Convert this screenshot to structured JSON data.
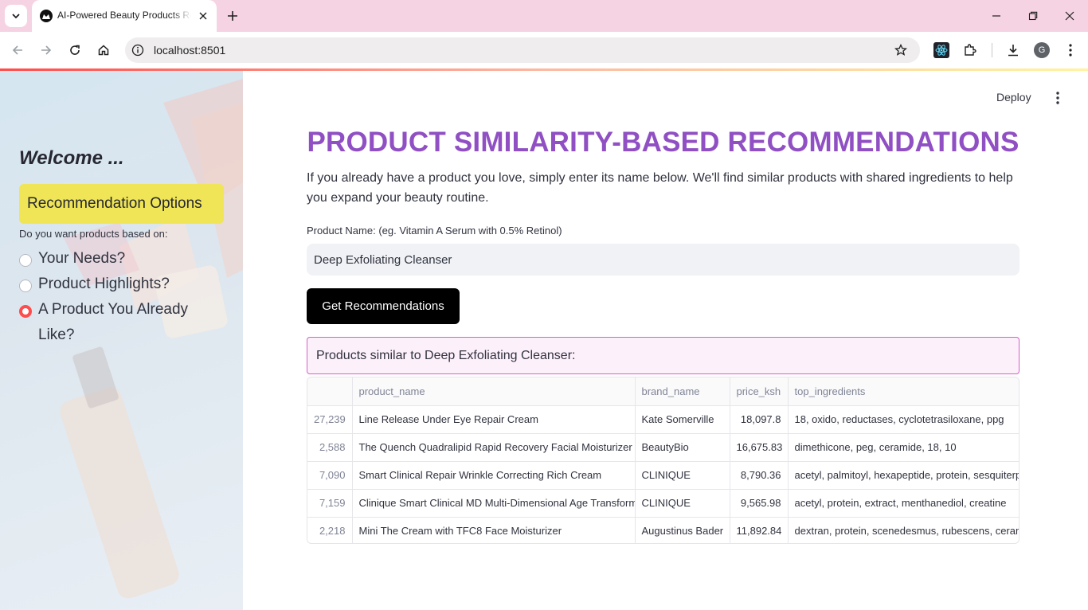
{
  "browser": {
    "tab_title": "AI-Powered Beauty Products Recommender",
    "url": "localhost:8501",
    "profile_initial": "G"
  },
  "sidebar": {
    "welcome": "Welcome ...",
    "options_header": "Recommendation Options",
    "question": "Do you want products based on:",
    "radio_options": [
      {
        "label": "Your Needs?",
        "selected": false
      },
      {
        "label": "Product Highlights?",
        "selected": false
      },
      {
        "label": "A Product You Already Like?",
        "selected": true
      }
    ]
  },
  "header": {
    "deploy_label": "Deploy"
  },
  "main": {
    "title": "PRODUCT SIMILARITY-BASED RECOMMENDATIONS",
    "intro": "If you already have a product you love, simply enter its name below. We'll find similar products with shared ingredients to help you expand your beauty routine.",
    "input_label": "Product Name: (eg. Vitamin A Serum with 0.5% Retinol)",
    "input_value": "Deep Exfoliating Cleanser",
    "button_label": "Get Recommendations",
    "result_message": "Products similar to Deep Exfoliating Cleanser:",
    "table": {
      "columns": [
        "",
        "product_name",
        "brand_name",
        "price_ksh",
        "top_ingredients"
      ],
      "rows": [
        [
          "27,239",
          "Line Release Under Eye Repair Cream",
          "Kate Somerville",
          "18,097.8",
          "18, oxido, reductases, cyclotetrasiloxane, ppg"
        ],
        [
          "2,588",
          "The Quench Quadralipid Rapid Recovery Facial Moisturizer",
          "BeautyBio",
          "16,675.83",
          "dimethicone, peg, ceramide, 18, 10"
        ],
        [
          "7,090",
          "Smart Clinical Repair Wrinkle Correcting Rich Cream",
          "CLINIQUE",
          "8,790.36",
          "acetyl, palmitoyl, hexapeptide, protein, sesquiterpene"
        ],
        [
          "7,159",
          "Clinique Smart Clinical MD Multi-Dimensional Age Transformer",
          "CLINIQUE",
          "9,565.98",
          "acetyl, protein, extract, menthanediol, creatine"
        ],
        [
          "2,218",
          "Mini The Cream with TFC8 Face Moisturizer",
          "Augustinus Bader",
          "11,892.84",
          "dextran, protein, scenedesmus, rubescens, ceramide"
        ]
      ]
    }
  },
  "colors": {
    "title": "#9050c4",
    "options_bg": "#efe557",
    "radio_selected": "#ff4b4b",
    "info_border": "#d660c8",
    "button_bg": "#000000"
  }
}
